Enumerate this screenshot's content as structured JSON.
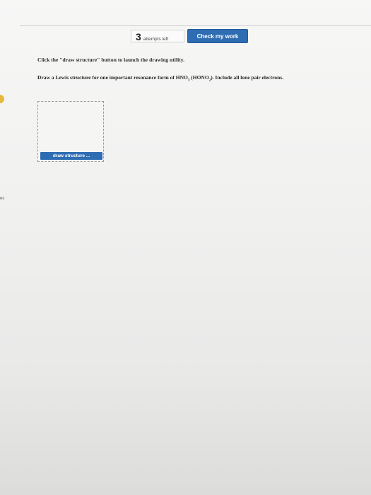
{
  "toolbar": {
    "attempts_count": "3",
    "attempts_label": "attempts left",
    "check_label": "Check my work"
  },
  "content": {
    "instruction": "Click the \"draw structure\" button to launch the drawing utility.",
    "question_part1": "Draw a Lewis structure for one important resonance form of HNO",
    "question_sub1": "3",
    "question_part2": " (HONO",
    "question_sub2": "2",
    "question_part3": "). Include all lone pair electrons."
  },
  "drawing": {
    "button_label": "draw structure ..."
  },
  "edge": {
    "fragment_text": "es"
  },
  "colors": {
    "accent": "#2f6db3",
    "marker": "#e8b83a"
  }
}
